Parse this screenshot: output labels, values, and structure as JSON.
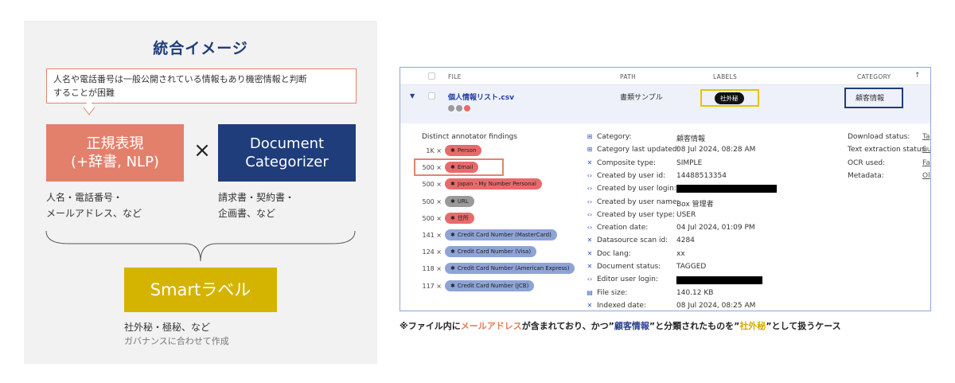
{
  "left": {
    "title": "統合イメージ",
    "callout_line1": "人名や電話番号は一般公開されている情報もあり機密情報と判断",
    "callout_line2": "することが困難",
    "regex_line1": "正規表現",
    "regex_line2": "(+辞書, NLP)",
    "times": "×",
    "doc_line1": "Document",
    "doc_line2": "Categorizer",
    "regex_sub1": "人名・電話番号・",
    "regex_sub2": "メールアドレス、など",
    "doc_sub1": "請求書・契約書・",
    "doc_sub2": "企画書、など",
    "smart_label": "Smartラベル",
    "bottom_line1": "社外秘・極秘、など",
    "bottom_line2": "ガバナンスに合わせて作成",
    "colors": {
      "regex": "#e2806c",
      "doc": "#1f3d7a",
      "smart": "#d4b400"
    }
  },
  "table": {
    "headers": {
      "file": "FILE",
      "path": "PATH",
      "labels": "LABELS",
      "category": "CATEGORY",
      "sort_icon": "↑"
    },
    "row": {
      "expand_icon": "▼",
      "file_name": "個人情報リスト.csv",
      "path": "書類サンプル",
      "label": "社外秘",
      "category": "顧客情報"
    },
    "findings_title": "Distinct annotator findings",
    "findings": [
      {
        "count": "1K ×",
        "label": "Person",
        "color": "red"
      },
      {
        "count": "500 ×",
        "label": "Email",
        "color": "red"
      },
      {
        "count": "500 ×",
        "label": "Japan - My Number Personal",
        "color": "red"
      },
      {
        "count": "500 ×",
        "label": "URL",
        "color": "gray"
      },
      {
        "count": "500 ×",
        "label": "住所",
        "color": "red"
      },
      {
        "count": "141 ×",
        "label": "Credit Card Number (MasterCard)",
        "color": "blue"
      },
      {
        "count": "124 ×",
        "label": "Credit Card Number (Visa)",
        "color": "blue"
      },
      {
        "count": "118 ×",
        "label": "Credit Card Number (American Express)",
        "color": "blue"
      },
      {
        "count": "117 ×",
        "label": "Credit Card Number (JCB)",
        "color": "blue"
      }
    ],
    "meta": [
      {
        "icon": "tag-icon",
        "glyph": "⊞",
        "key": "Category:",
        "value": "顧客情報"
      },
      {
        "icon": "tag-icon",
        "glyph": "⊞",
        "key": "Category last updated:",
        "value": "08 Jul 2024, 08:28 AM"
      },
      {
        "icon": "cross-icon",
        "glyph": "✕",
        "key": "Composite type:",
        "value": "SIMPLE"
      },
      {
        "icon": "code-icon",
        "glyph": "‹›",
        "key": "Created by user id:",
        "value": "14488513354"
      },
      {
        "icon": "code-icon",
        "glyph": "‹›",
        "key": "Created by user login:",
        "value": ""
      },
      {
        "icon": "code-icon",
        "glyph": "‹›",
        "key": "Created by user name:",
        "value": "Box 管理者"
      },
      {
        "icon": "code-icon",
        "glyph": "‹›",
        "key": "Created by user type:",
        "value": "USER"
      },
      {
        "icon": "code-icon",
        "glyph": "‹›",
        "key": "Creation date:",
        "value": "04 Jul 2024, 01:09 PM"
      },
      {
        "icon": "cross-icon",
        "glyph": "✕",
        "key": "Datasource scan id:",
        "value": "4284"
      },
      {
        "icon": "cross-icon",
        "glyph": "✕",
        "key": "Doc lang:",
        "value": "xx"
      },
      {
        "icon": "cross-icon",
        "glyph": "✕",
        "key": "Document status:",
        "value": "TAGGED"
      },
      {
        "icon": "code-icon",
        "glyph": "‹›",
        "key": "Editor user login:",
        "value": ""
      },
      {
        "icon": "file-icon",
        "glyph": "▤",
        "key": "File size:",
        "value": "140.12 KB"
      },
      {
        "icon": "cross-icon",
        "glyph": "✕",
        "key": "Indexed date:",
        "value": "08 Jul 2024, 08:25 AM"
      }
    ],
    "right_meta": [
      {
        "key": "Download status:",
        "value": "Ta"
      },
      {
        "key": "Text extraction status:",
        "value": "Su"
      },
      {
        "key": "OCR used:",
        "value": "Fa"
      },
      {
        "key": "Metadata:",
        "value": "Ol"
      }
    ]
  },
  "caption": {
    "p1": "※ファイル内に",
    "p2": "メールアドレス",
    "p3": "が含まれており、かつ”",
    "p4": "顧客情報",
    "p5": "”と分類されたものを”",
    "p6": "社外秘",
    "p7": "”として扱うケース"
  }
}
